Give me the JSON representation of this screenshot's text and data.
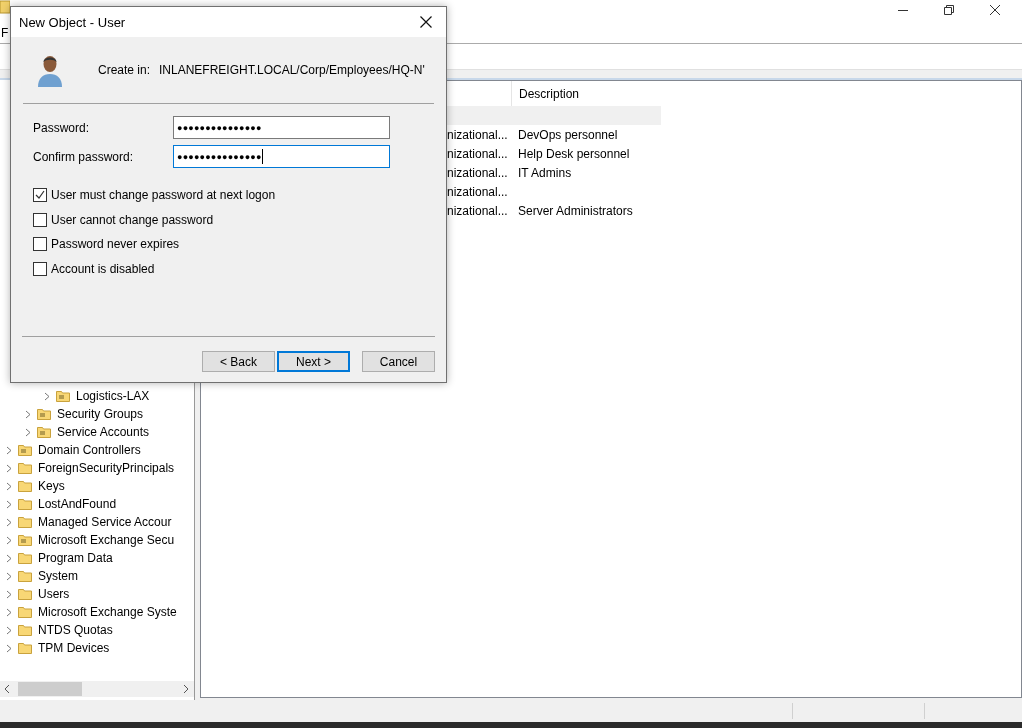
{
  "app_window": {
    "menu": [
      "F"
    ]
  },
  "tree": {
    "items": [
      {
        "children": [
          {
            "children": [
              {
                "label": "Logistics-LAX",
                "kind": "ou"
              }
            ]
          },
          {
            "label": "Security Groups",
            "kind": "ou"
          },
          {
            "label": "Service Accounts",
            "kind": "ou"
          }
        ]
      },
      {
        "label": "Domain Controllers",
        "kind": "ou"
      },
      {
        "label": "ForeignSecurityPrincipals",
        "kind": "folder"
      },
      {
        "label": "Keys",
        "kind": "folder"
      },
      {
        "label": "LostAndFound",
        "kind": "folder"
      },
      {
        "label": "Managed Service Accour",
        "kind": "folder"
      },
      {
        "label": "Microsoft Exchange Secu",
        "kind": "ou"
      },
      {
        "label": "Program Data",
        "kind": "folder"
      },
      {
        "label": "System",
        "kind": "folder"
      },
      {
        "label": "Users",
        "kind": "folder"
      },
      {
        "label": "Microsoft Exchange Syste",
        "kind": "folder"
      },
      {
        "label": "NTDS Quotas",
        "kind": "folder"
      },
      {
        "label": "TPM Devices",
        "kind": "folder"
      }
    ]
  },
  "list": {
    "columns": [
      "Description"
    ],
    "rows": [
      {
        "selected": true
      },
      {
        "selected": false,
        "column_1": "nizational...",
        "description": "DevOps personnel"
      },
      {
        "selected": false,
        "column_1": "nizational...",
        "description": "Help Desk personnel"
      },
      {
        "selected": false,
        "column_1": "nizational...",
        "description": "IT Admins"
      },
      {
        "selected": false,
        "column_1": "nizational..."
      },
      {
        "selected": false,
        "column_1": "nizational...",
        "description": "Server Administrators"
      }
    ]
  },
  "dialog": {
    "title": "New Object - User",
    "create_in_label": "Create in:",
    "create_in_path": "INLANEFREIGHT.LOCAL/Corp/Employees/HQ-N'",
    "fields": [
      {
        "label": "Password:",
        "value": "●●●●●●●●●●●●●●●",
        "focused": false
      },
      {
        "label": "Confirm password:",
        "value": "●●●●●●●●●●●●●●●",
        "focused": true
      }
    ],
    "options": [
      {
        "label": "User must change password at next logon",
        "checked": true
      },
      {
        "label": "User cannot change password",
        "checked": false
      },
      {
        "label": "Password never expires",
        "checked": false
      },
      {
        "label": "Account is disabled",
        "checked": false
      }
    ],
    "buttons": [
      {
        "label": "< Back",
        "default": false
      },
      {
        "label": "Next >",
        "default": true
      },
      {
        "label": "Cancel",
        "default": false
      }
    ]
  }
}
